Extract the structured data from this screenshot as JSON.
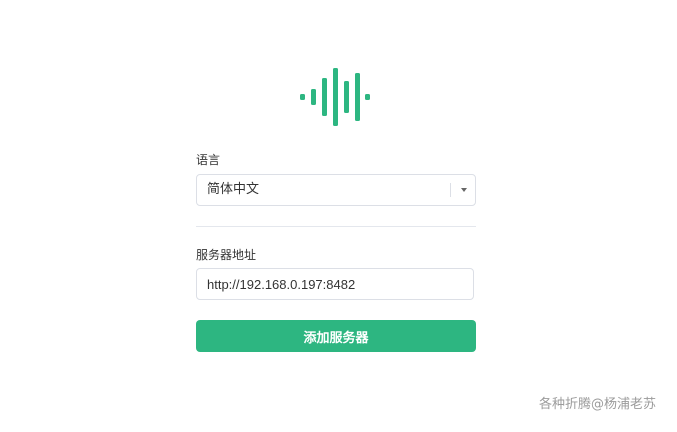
{
  "logo": {
    "icon": "sound-wave-icon",
    "color": "#2db681"
  },
  "language": {
    "label": "语言",
    "selected": "简体中文"
  },
  "server": {
    "label": "服务器地址",
    "value": "http://192.168.0.197:8482"
  },
  "add_button": {
    "label": "添加服务器",
    "color": "#2db681"
  },
  "watermark": "各种折腾@杨浦老苏"
}
